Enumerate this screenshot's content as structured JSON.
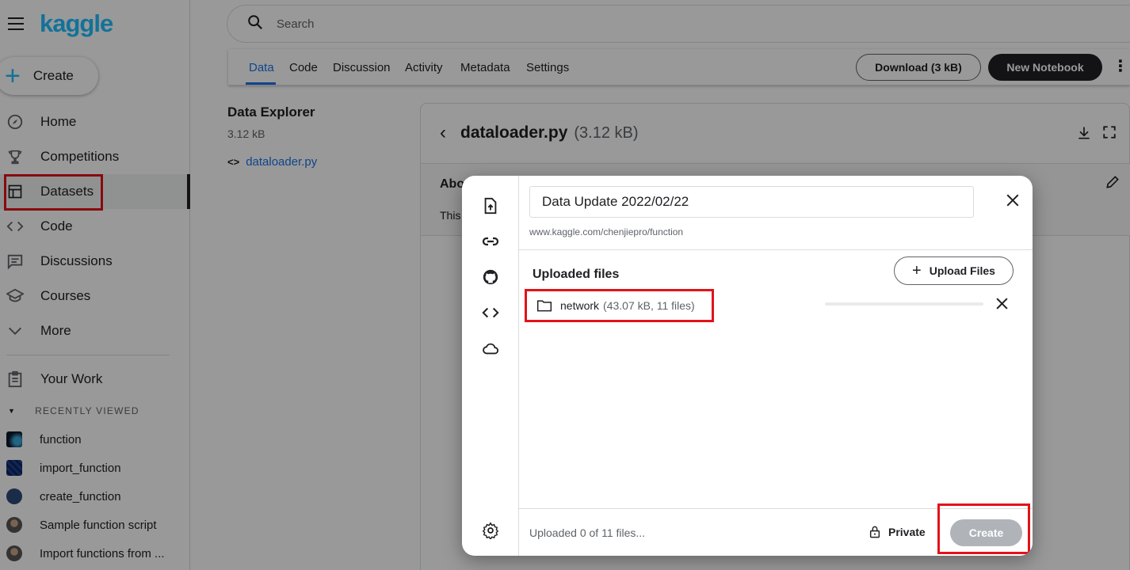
{
  "brand": {
    "logo": "kaggle",
    "accent": "#20beff"
  },
  "sidebar": {
    "create_label": "Create",
    "items": [
      {
        "label": "Home",
        "icon": "compass-icon"
      },
      {
        "label": "Competitions",
        "icon": "trophy-icon"
      },
      {
        "label": "Datasets",
        "icon": "table-icon",
        "active": true
      },
      {
        "label": "Code",
        "icon": "code-icon"
      },
      {
        "label": "Discussions",
        "icon": "comments-icon"
      },
      {
        "label": "Courses",
        "icon": "school-icon"
      },
      {
        "label": "More",
        "icon": "chevron-down-icon"
      }
    ],
    "your_work": "Your Work",
    "recent_heading": "RECENTLY VIEWED",
    "recent": [
      {
        "label": "function"
      },
      {
        "label": "import_function"
      },
      {
        "label": "create_function"
      },
      {
        "label": "Sample function script"
      },
      {
        "label": "Import functions from ..."
      }
    ]
  },
  "search": {
    "placeholder": "Search"
  },
  "tabs": [
    "Data",
    "Code",
    "Discussion",
    "Activity",
    "Metadata",
    "Settings"
  ],
  "actions": {
    "download": "Download (3 kB)",
    "new_notebook": "New Notebook"
  },
  "explorer": {
    "title": "Data Explorer",
    "size": "3.12 kB",
    "file": "dataloader.py"
  },
  "file_view": {
    "name": "dataloader.py",
    "size": "(3.12 kB)",
    "about": "Abo",
    "about_text": "This"
  },
  "modal": {
    "title_value": "Data Update 2022/02/22",
    "url": "www.kaggle.com/chenjiepro/function",
    "uploaded_heading": "Uploaded files",
    "upload_button": "Upload Files",
    "files": [
      {
        "name": "network",
        "meta": "(43.07 kB, 11 files)",
        "progress": 0
      }
    ],
    "status": "Uploaded 0 of 11 files...",
    "privacy": "Private",
    "create_button": "Create"
  },
  "colors": {
    "highlight": "#e3121a",
    "link": "#1a73e8"
  }
}
